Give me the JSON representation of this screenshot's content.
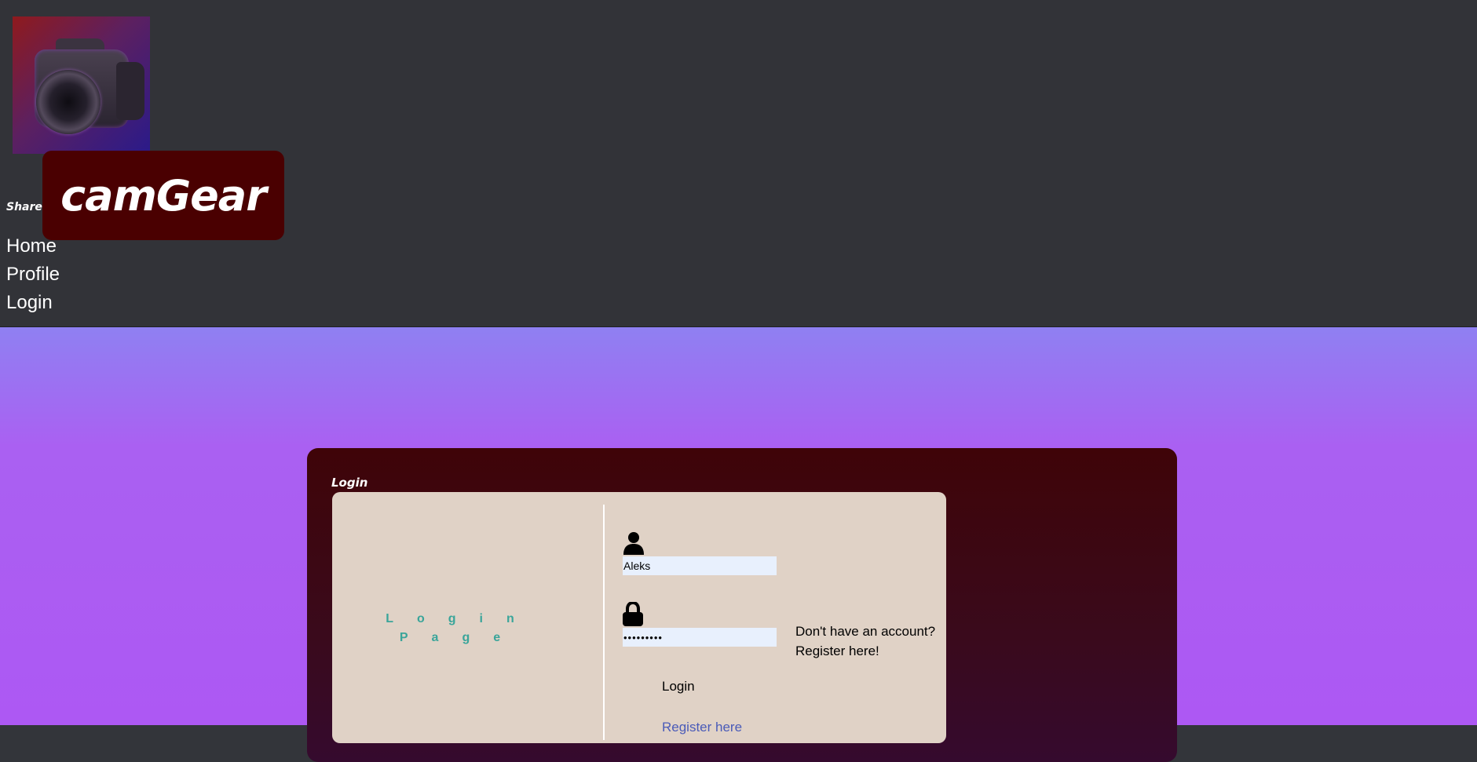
{
  "header": {
    "share_label": "Share",
    "brand_name": "camGear",
    "nav": [
      {
        "label": "Home"
      },
      {
        "label": "Profile"
      },
      {
        "label": "Login"
      }
    ]
  },
  "login_panel": {
    "title": "Login",
    "page_heading_line1": "Login",
    "page_heading_line2": "Page",
    "username_value": "Aleks",
    "password_value": "•••••••••",
    "login_button_label": "Login",
    "register_link_label": "Register here",
    "no_account_text": "Don't have an account? Register here!"
  },
  "colors": {
    "header_bg": "#323338",
    "brand_bg": "#4a0001",
    "panel_bg": "#3f0408",
    "card_bg": "#e0d2c6",
    "accent_teal": "#3aa59a"
  },
  "icons": [
    "camera-logo-icon",
    "user-icon",
    "lock-icon"
  ]
}
